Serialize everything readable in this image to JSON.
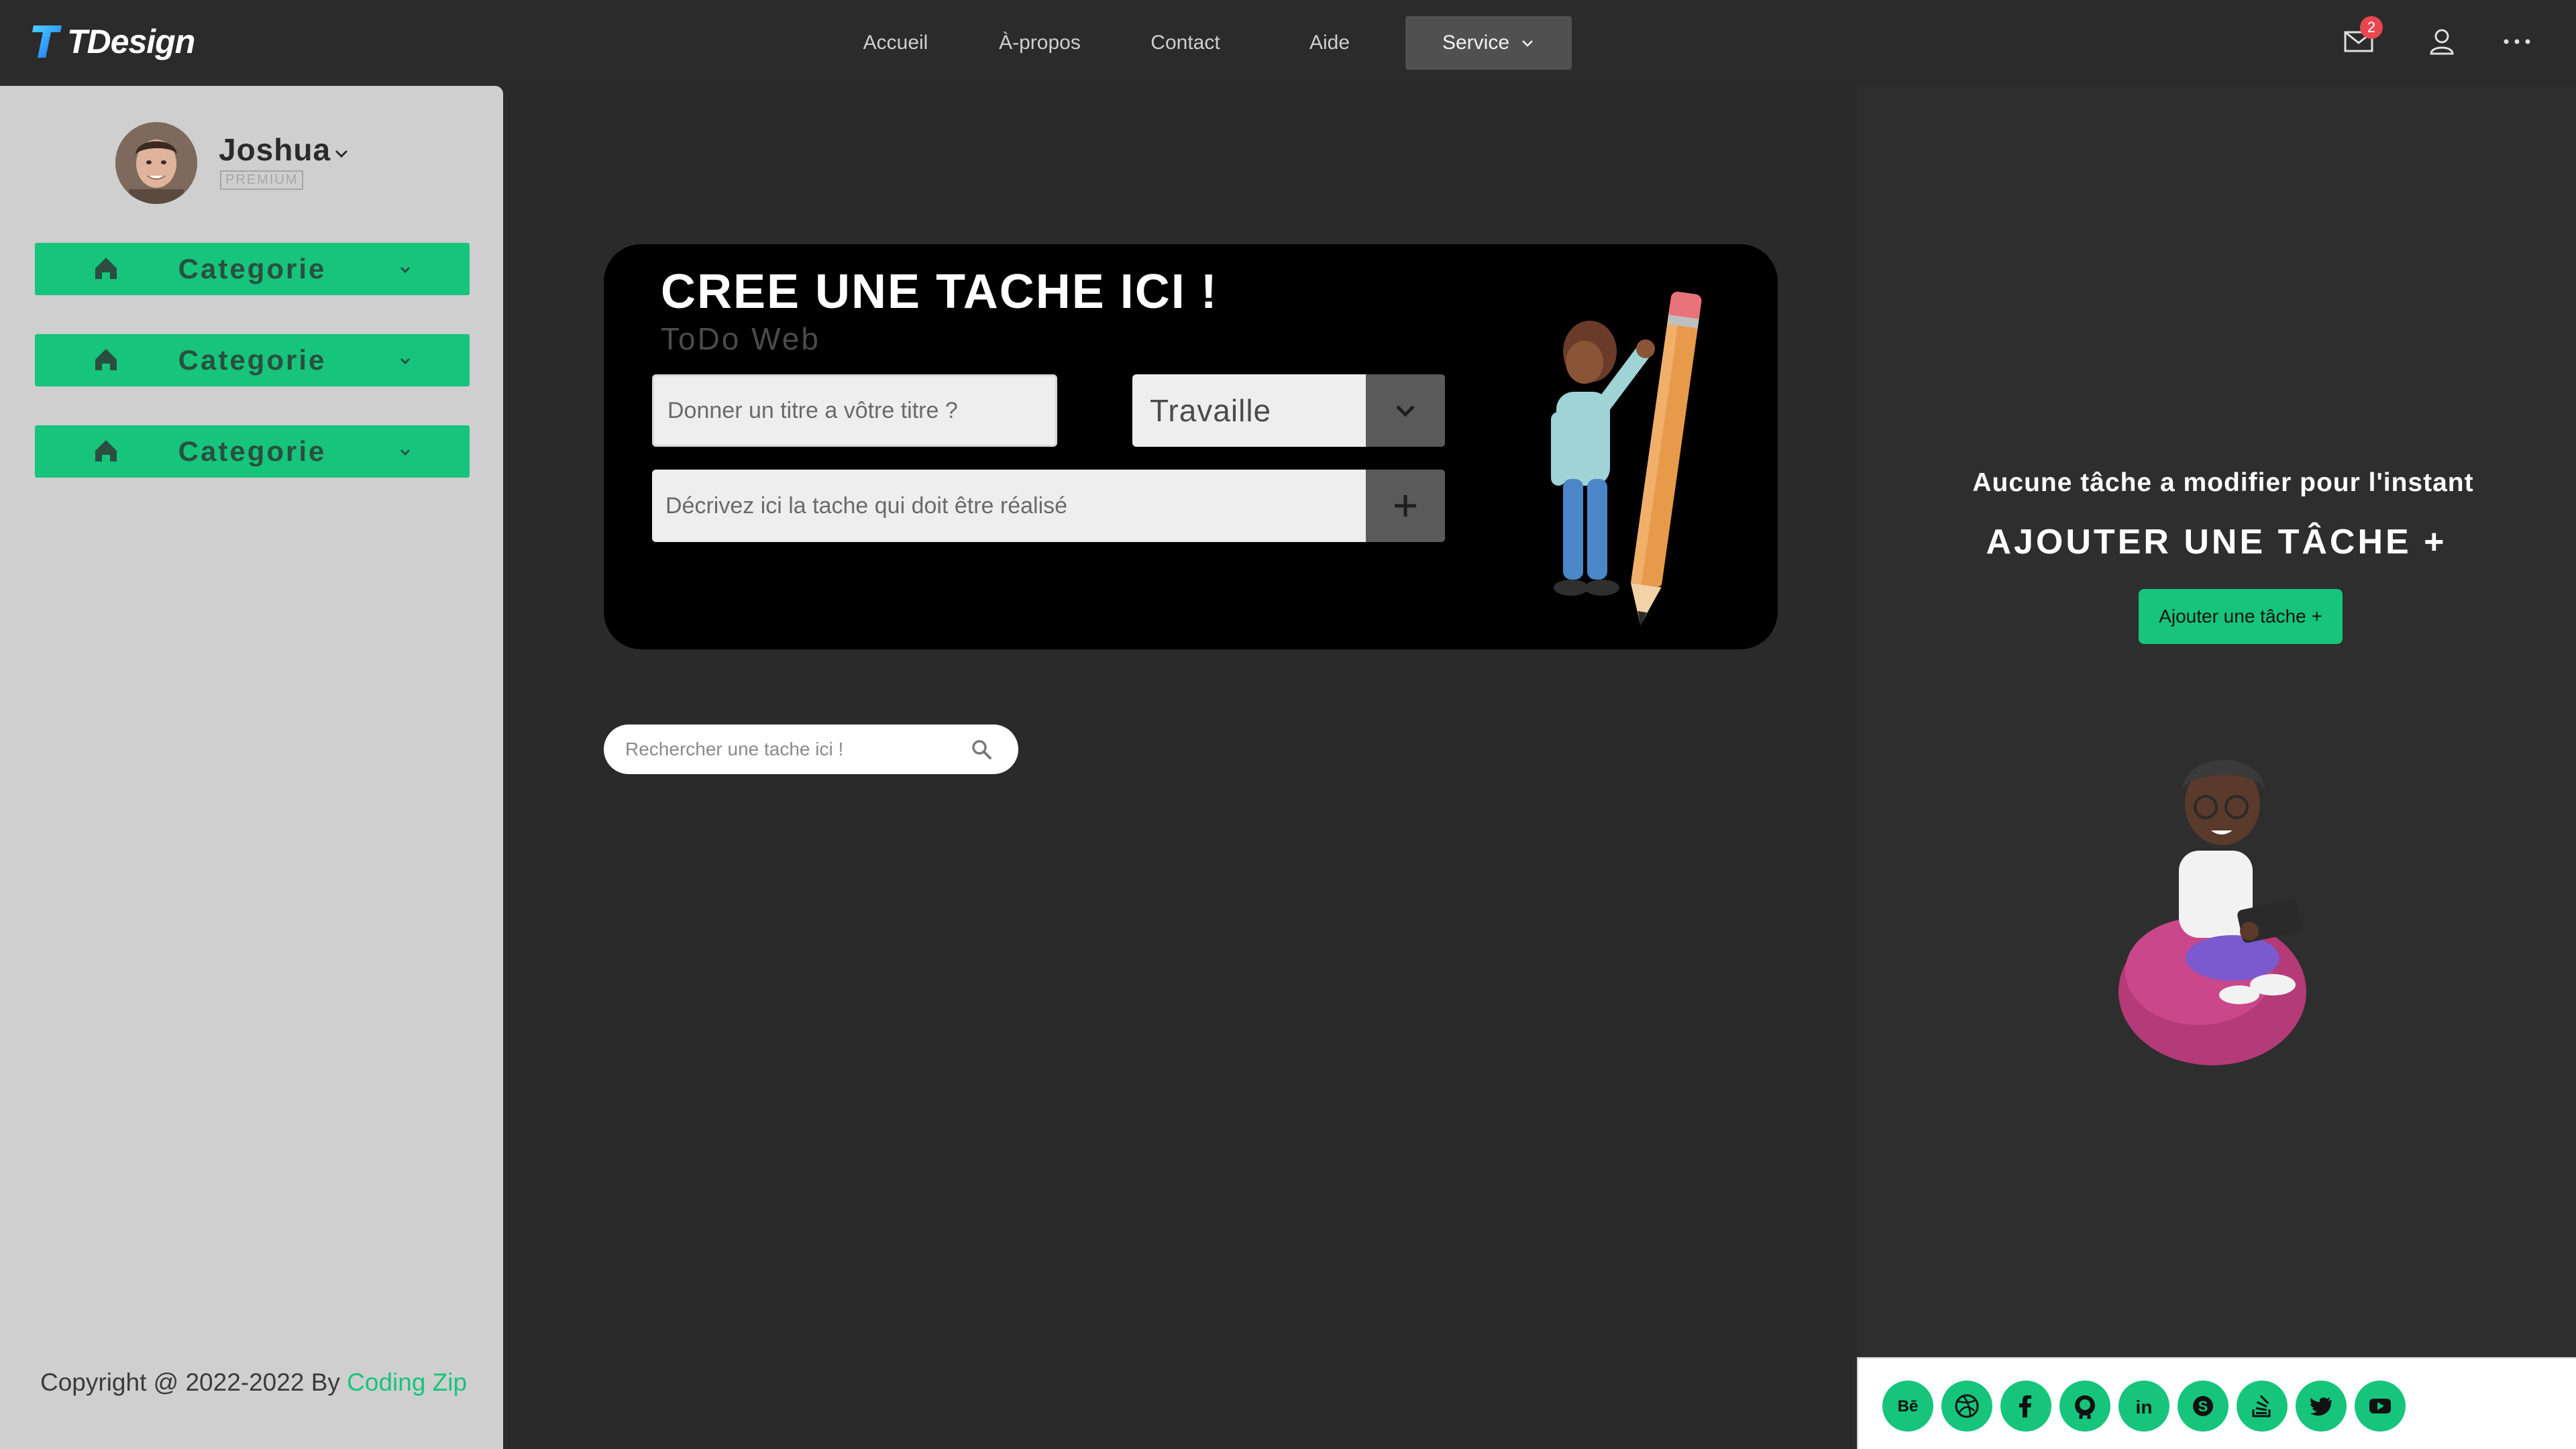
{
  "app": {
    "logo_text": "TDesign"
  },
  "nav": {
    "items": [
      {
        "label": "Accueil"
      },
      {
        "label": "À-propos"
      },
      {
        "label": "Contact"
      },
      {
        "label": "Aide"
      }
    ],
    "service_label": "Service",
    "mail_badge": "2",
    "icons": [
      "mail-icon",
      "user-icon",
      "more-icon"
    ]
  },
  "sidebar": {
    "user_name": "Joshua",
    "user_tier": "PREMIUM",
    "categories": [
      {
        "label": "Categorie",
        "icon": "home-icon"
      },
      {
        "label": "Categorie",
        "icon": "home-icon"
      },
      {
        "label": "Categorie",
        "icon": "home-icon"
      }
    ],
    "copyright_prefix": "Copyright @ 2022-2022 By ",
    "copyright_link": "Coding Zip"
  },
  "task_form": {
    "title": "CREE UNE TACHE ICI !",
    "subtitle": "ToDo Web",
    "title_placeholder": "Donner un titre a vôtre titre ?",
    "category_value": "Travaille",
    "desc_placeholder": "Décrivez ici la tache qui doit être réalisé"
  },
  "search": {
    "placeholder": "Rechercher une tache ici !"
  },
  "right_panel": {
    "empty_message": "Aucune tâche a modifier pour l'instant",
    "add_title": "AJOUTER UNE TÂCHE +",
    "add_button": "Ajouter une tâche +"
  },
  "social": {
    "icons": [
      "behance-icon",
      "dribbble-icon",
      "facebook-icon",
      "github-icon",
      "linkedin-icon",
      "skype-icon",
      "stackoverflow-icon",
      "twitter-icon",
      "youtube-icon"
    ]
  },
  "colors": {
    "accent": "#17c47c",
    "background": "#2a2a2a",
    "sidebar": "#cfcfcf",
    "card": "#000000",
    "badge": "#e8474f"
  }
}
